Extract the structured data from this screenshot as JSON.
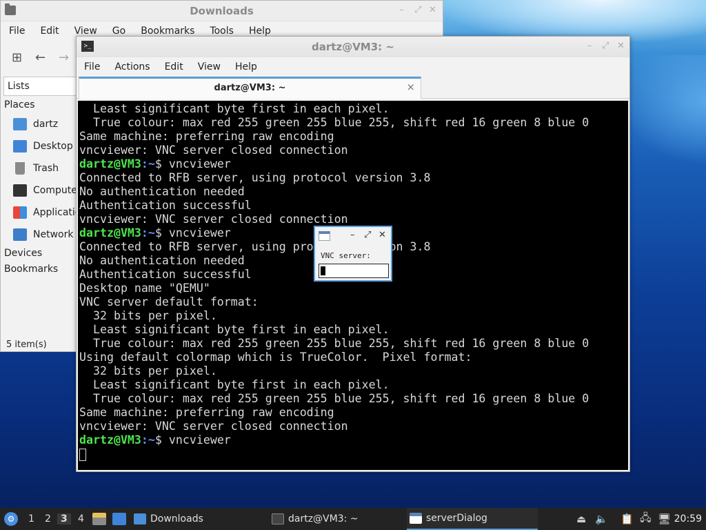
{
  "file_manager": {
    "title": "Downloads",
    "menu": [
      "File",
      "Edit",
      "View",
      "Go",
      "Bookmarks",
      "Tools",
      "Help"
    ],
    "side_pane_mode": "Lists",
    "places_header": "Places",
    "places": [
      {
        "label": "dartz",
        "icon": "home-folder-icon"
      },
      {
        "label": "Desktop",
        "icon": "desktop-icon"
      },
      {
        "label": "Trash",
        "icon": "trash-icon"
      },
      {
        "label": "Computer",
        "icon": "computer-icon"
      },
      {
        "label": "Applications",
        "icon": "applications-icon"
      },
      {
        "label": "Network",
        "icon": "network-icon"
      }
    ],
    "devices_header": "Devices",
    "bookmarks_header": "Bookmarks",
    "status": "5 item(s)"
  },
  "terminal": {
    "title": "dartz@VM3: ~",
    "menu": [
      "File",
      "Actions",
      "Edit",
      "View",
      "Help"
    ],
    "tab_label": "dartz@VM3: ~",
    "tab_close": "×",
    "prompt_user": "dartz@VM3",
    "prompt_path": ":~",
    "lines": [
      {
        "text": "  Least significant byte first in each pixel."
      },
      {
        "text": "  True colour: max red 255 green 255 blue 255, shift red 16 green 8 blue 0"
      },
      {
        "text": "Same machine: preferring raw encoding"
      },
      {
        "text": "vncviewer: VNC server closed connection"
      },
      {
        "prompt": true,
        "text": "$ vncviewer"
      },
      {
        "text": "Connected to RFB server, using protocol version 3.8"
      },
      {
        "text": "No authentication needed"
      },
      {
        "text": "Authentication successful"
      },
      {
        "text": "vncviewer: VNC server closed connection"
      },
      {
        "prompt": true,
        "text": "$ vncviewer"
      },
      {
        "text": "Connected to RFB server, using protocol version 3.8"
      },
      {
        "text": "No authentication needed"
      },
      {
        "text": "Authentication successful"
      },
      {
        "text": "Desktop name \"QEMU\""
      },
      {
        "text": "VNC server default format:"
      },
      {
        "text": "  32 bits per pixel."
      },
      {
        "text": "  Least significant byte first in each pixel."
      },
      {
        "text": "  True colour: max red 255 green 255 blue 255, shift red 16 green 8 blue 0"
      },
      {
        "text": "Using default colormap which is TrueColor.  Pixel format:"
      },
      {
        "text": "  32 bits per pixel."
      },
      {
        "text": "  Least significant byte first in each pixel."
      },
      {
        "text": "  True colour: max red 255 green 255 blue 255, shift red 16 green 8 blue 0"
      },
      {
        "text": "Same machine: preferring raw encoding"
      },
      {
        "text": "vncviewer: VNC server closed connection"
      },
      {
        "prompt": true,
        "text": "$ vncviewer"
      }
    ]
  },
  "dialog": {
    "label": "VNC server:",
    "input_value": ""
  },
  "taskbar": {
    "workspaces": [
      "1",
      "2",
      "3",
      "4"
    ],
    "active_workspace": "3",
    "tasks": [
      {
        "label": "Downloads",
        "icon": "folder-icon"
      },
      {
        "label": "dartz@VM3: ~",
        "icon": "terminal-icon"
      },
      {
        "label": "serverDialog",
        "icon": "window-icon",
        "active": true
      }
    ],
    "clock": "20:59"
  },
  "colors": {
    "accent": "#5b9bd5",
    "prompt_user": "#4ee44e",
    "prompt_path": "#6a8cff",
    "terminal_bg": "#000000",
    "taskbar_bg": "#232323"
  }
}
